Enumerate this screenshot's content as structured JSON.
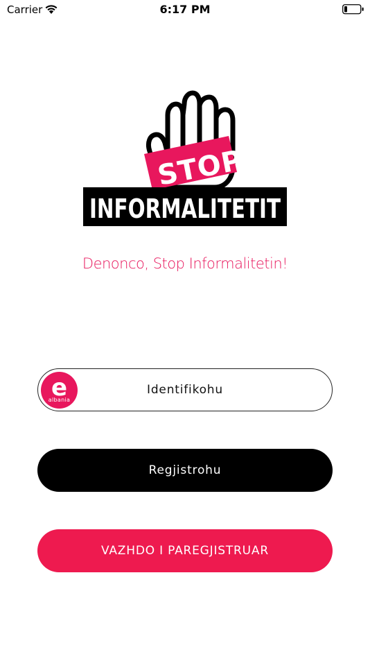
{
  "status_bar": {
    "carrier": "Carrier",
    "time": "6:17 PM"
  },
  "logo": {
    "stop_text": "STOP",
    "banner_text": "INFORMALITETIT",
    "accent_color": "#e8175d"
  },
  "tagline": "Denonco, Stop Informalitetin!",
  "buttons": {
    "identify": {
      "label": "Identifikohu",
      "badge_letter": "e",
      "badge_text": "albania"
    },
    "register": {
      "label": "Regjistrohu"
    },
    "continue": {
      "label": "VAZHDO I PAREGJISTRUAR"
    }
  },
  "colors": {
    "brand_pink": "#e8175d",
    "continue_button": "#ee1a4f",
    "register_button": "#000000"
  }
}
